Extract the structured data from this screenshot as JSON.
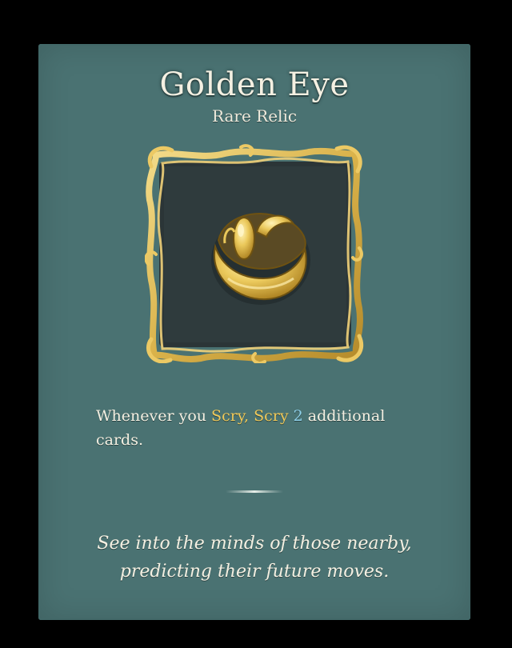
{
  "relic": {
    "name": "Golden Eye",
    "rarity": "Rare Relic",
    "description": {
      "prefix": "Whenever you ",
      "keyword1": "Scry",
      "sep": ", ",
      "keyword2": "Scry",
      "space": " ",
      "amount": "2",
      "suffix": " additional cards."
    },
    "flavor": "See into the minds of those nearby, predicting their future moves."
  },
  "icons": {
    "relic_art": "golden-eye-icon",
    "frame": "ornate-gold-frame",
    "divider": "divider-line"
  },
  "colors": {
    "panel": "#4a7272",
    "keyword": "#f0c95a",
    "number": "#8fd1ea",
    "gold": "#e3c15a"
  }
}
